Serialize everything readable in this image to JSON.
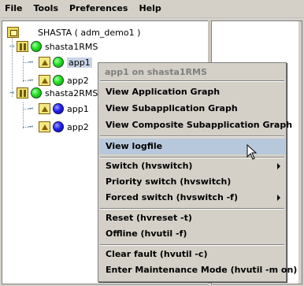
{
  "menubar": {
    "items": [
      "File",
      "Tools",
      "Preferences",
      "Help"
    ]
  },
  "tree": {
    "root": {
      "label": "SHASTA ( adm_demo1 )",
      "icon": "cluster-icon"
    },
    "systems": [
      {
        "label": "shasta1RMS",
        "status": "online",
        "apps": [
          {
            "label": "app1",
            "status": "online",
            "selected": true
          },
          {
            "label": "app2",
            "status": "online",
            "selected": false
          }
        ]
      },
      {
        "label": "shasta2RMS",
        "status": "online",
        "apps": [
          {
            "label": "app1",
            "status": "offline",
            "selected": false
          },
          {
            "label": "app2",
            "status": "offline",
            "selected": false
          }
        ]
      }
    ]
  },
  "context_menu": {
    "title": "app1 on shasta1RMS",
    "groups": [
      [
        "View Application Graph",
        "View Subapplication Graph",
        "View Composite Subapplication Graph"
      ],
      [
        "View logfile"
      ],
      [
        "Switch (hvswitch)",
        "Priority switch (hvswitch)",
        "Forced switch (hvswitch -f)"
      ],
      [
        "Reset (hvreset -t)",
        "Offline (hvutil -f)"
      ],
      [
        "Clear fault (hvutil -c)",
        "Enter Maintenance Mode (hvutil -m on)"
      ]
    ],
    "highlighted": "View logfile",
    "submenu_items": [
      "Switch (hvswitch)",
      "Forced switch (hvswitch -f)"
    ]
  },
  "colors": {
    "online": "#20e020",
    "offline": "#2020f0",
    "highlight": "#b8c8dc",
    "selection": "#c8d4e6"
  }
}
